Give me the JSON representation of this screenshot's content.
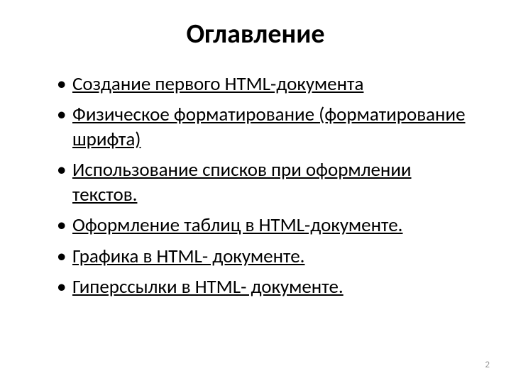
{
  "title": "Оглавление",
  "toc": {
    "items": [
      {
        "text": "Создание первого HTML-документа"
      },
      {
        "text": "Физическое форматирование (форматирование шрифта)"
      },
      {
        "text": "Использование списков при оформлении текстов."
      },
      {
        "text": "Оформление таблиц в HTML-документе."
      },
      {
        "text": "Графика в HTML- документе."
      },
      {
        "text": "Гиперссылки в HTML- документе. "
      }
    ]
  },
  "page_number": "2"
}
